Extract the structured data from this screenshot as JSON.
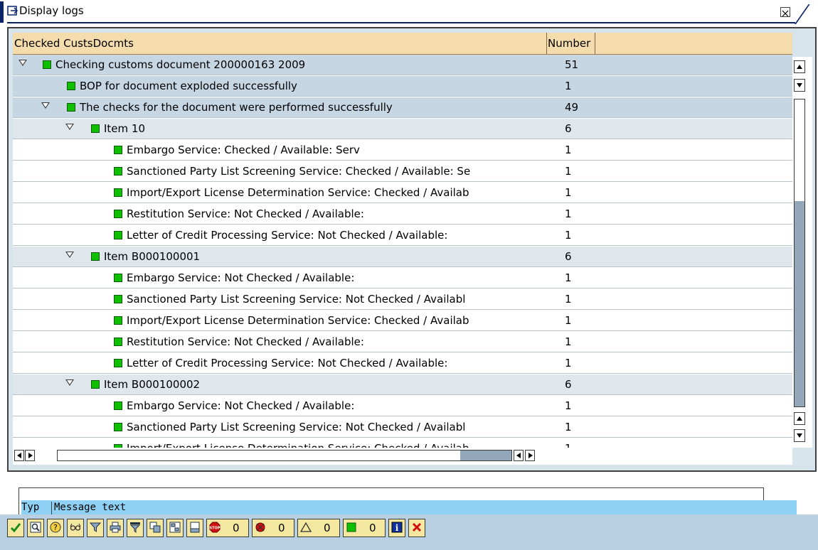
{
  "window": {
    "title": "Display logs"
  },
  "columns": {
    "col1": "Checked CustsDocmts",
    "col2": "Number"
  },
  "rows": [
    {
      "text": "Checking customs document 200000163 2009",
      "count": "51",
      "level": 0,
      "expand": true
    },
    {
      "text": "BOP for document exploded successfully",
      "count": "1",
      "level": 1,
      "expand": false
    },
    {
      "text": "The checks for the document were performed successfully",
      "count": "49",
      "level": 1,
      "expand": true
    },
    {
      "text": "Item 10",
      "count": "6",
      "level": 2,
      "expand": true
    },
    {
      "text": "Embargo Service: Checked / Available: Serv",
      "count": "1",
      "level": 3,
      "expand": false
    },
    {
      "text": "Sanctioned Party List Screening Service: Checked / Available: Se",
      "count": "1",
      "level": 3,
      "expand": false
    },
    {
      "text": "Import/Export License Determination Service: Checked / Availab",
      "count": "1",
      "level": 3,
      "expand": false
    },
    {
      "text": "Restitution Service: Not Checked / Available:",
      "count": "1",
      "level": 3,
      "expand": false
    },
    {
      "text": "Letter of Credit Processing Service: Not Checked / Available:",
      "count": "1",
      "level": 3,
      "expand": false
    },
    {
      "text": "Item B000100001",
      "count": "6",
      "level": 2,
      "expand": true
    },
    {
      "text": "Embargo Service: Not Checked / Available:",
      "count": "1",
      "level": 3,
      "expand": false
    },
    {
      "text": "Sanctioned Party List Screening Service: Not Checked / Availabl",
      "count": "1",
      "level": 3,
      "expand": false
    },
    {
      "text": "Import/Export License Determination Service: Checked / Availab",
      "count": "1",
      "level": 3,
      "expand": false
    },
    {
      "text": "Restitution Service: Not Checked / Available:",
      "count": "1",
      "level": 3,
      "expand": false
    },
    {
      "text": "Letter of Credit Processing Service: Not Checked / Available:",
      "count": "1",
      "level": 3,
      "expand": false
    },
    {
      "text": "Item B000100002",
      "count": "6",
      "level": 2,
      "expand": true
    },
    {
      "text": "Embargo Service: Not Checked / Available:",
      "count": "1",
      "level": 3,
      "expand": false
    },
    {
      "text": "Sanctioned Party List Screening Service: Not Checked / Availabl",
      "count": "1",
      "level": 3,
      "expand": false
    },
    {
      "text": "Import/Export License Determination Service: Checked / Availab",
      "count": "1",
      "level": 3,
      "expand": false
    }
  ],
  "messages": {
    "col_type": "Typ",
    "col_text": "Message text"
  },
  "toolbar": {
    "stop_count": "0",
    "error_count": "0",
    "warning_count": "0",
    "success_count": "0"
  },
  "colors": {
    "led_green": "#0fc000",
    "selected_row": "#c7d6e3",
    "header": "#f5dcac",
    "toolbar": "#b9cfe2"
  }
}
